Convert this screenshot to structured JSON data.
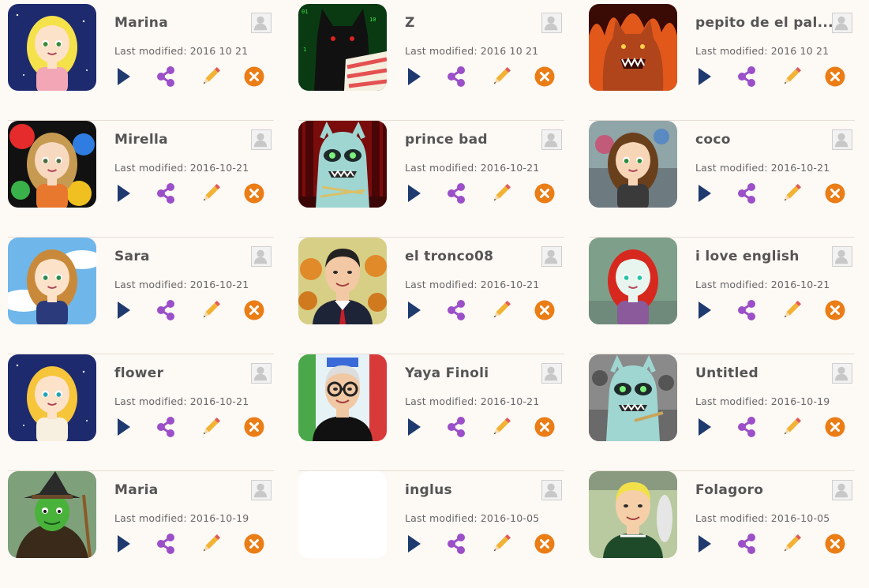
{
  "labels": {
    "modified_prefix": "Last modified:"
  },
  "accent_colors": {
    "play": "#1e3a6e",
    "share": "#9b4fc8",
    "edit": "#f2b233",
    "delete": "#ea7d16"
  },
  "cards": [
    {
      "title": "Marina",
      "date": "2016 10 21",
      "avatar": "blonde-girl-night"
    },
    {
      "title": "Z",
      "date": "2016 10 21",
      "avatar": "black-wolf-matrix"
    },
    {
      "title": "pepito de el pal...",
      "date": "2016 10 21",
      "avatar": "werewolf-fire"
    },
    {
      "title": "Mirella",
      "date": "2016-10-21",
      "avatar": "girl-paint-splash"
    },
    {
      "title": "prince bad",
      "date": "2016-10-21",
      "avatar": "monster-stage"
    },
    {
      "title": "coco",
      "date": "2016-10-21",
      "avatar": "girl-graffiti"
    },
    {
      "title": "Sara",
      "date": "2016-10-21",
      "avatar": "girl-sky"
    },
    {
      "title": "el tronco08",
      "date": "2016-10-21",
      "avatar": "man-pumpkins"
    },
    {
      "title": "i love english",
      "date": "2016-10-21",
      "avatar": "redhead-girl"
    },
    {
      "title": "flower",
      "date": "2016-10-21",
      "avatar": "blonde-girl-night-2"
    },
    {
      "title": "Yaya Finoli",
      "date": "2016-10-21",
      "avatar": "man-glasses-store"
    },
    {
      "title": "Untitled",
      "date": "2016-10-19",
      "avatar": "monster-grey"
    },
    {
      "title": "Maria",
      "date": "2016-10-19",
      "avatar": "green-witch"
    },
    {
      "title": "inglus",
      "date": "2016-10-05",
      "avatar": "blank"
    },
    {
      "title": "Folagoro",
      "date": "2016-10-05",
      "avatar": "boy-baseball"
    }
  ]
}
